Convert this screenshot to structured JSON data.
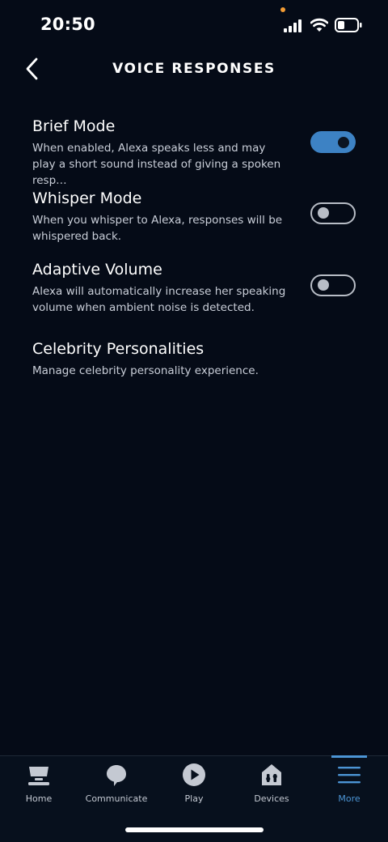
{
  "status_bar": {
    "time": "20:50"
  },
  "header": {
    "title": "VOICE RESPONSES"
  },
  "settings": [
    {
      "title": "Brief Mode",
      "description": "When enabled, Alexa speaks less and may play a short sound instead of giving a spoken resp…",
      "toggle": "on"
    },
    {
      "title": "Whisper Mode",
      "description": "When you whisper to Alexa, responses will be whispered back.",
      "toggle": "off"
    },
    {
      "title": "Adaptive Volume",
      "description": "Alexa will automatically increase her speaking volume when ambient noise is detected.",
      "toggle": "off"
    },
    {
      "title": "Celebrity Personalities",
      "description": "Manage celebrity personality experience."
    }
  ],
  "tabs": [
    {
      "label": "Home",
      "icon": "home-icon"
    },
    {
      "label": "Communicate",
      "icon": "speech-bubble-icon"
    },
    {
      "label": "Play",
      "icon": "play-icon"
    },
    {
      "label": "Devices",
      "icon": "devices-house-icon"
    },
    {
      "label": "More",
      "icon": "menu-icon",
      "active": true
    }
  ],
  "colors": {
    "background": "#050b17",
    "accent": "#3d82c4",
    "active_tab": "#4c95d5",
    "secondary_text": "#c9ced8"
  }
}
